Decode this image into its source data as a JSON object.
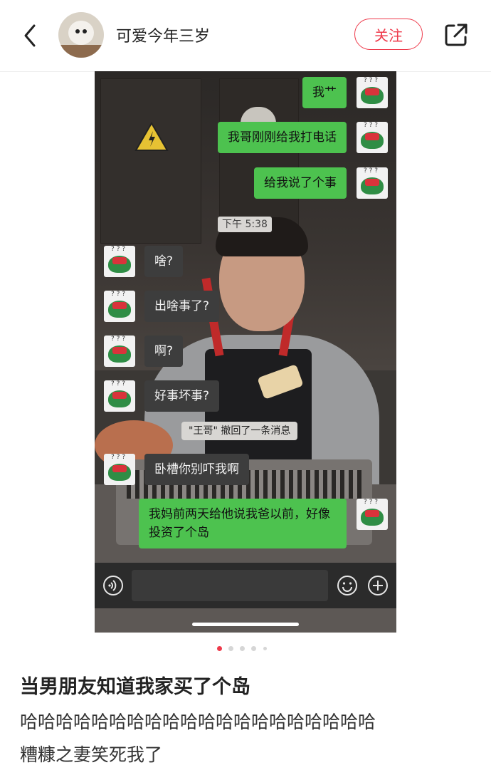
{
  "header": {
    "username": "可爱今年三岁",
    "follow_label": "关注"
  },
  "chat": {
    "messages": [
      {
        "side": "me",
        "text": "我艹"
      },
      {
        "side": "me",
        "text": "我哥刚刚给我打电话"
      },
      {
        "side": "me",
        "text": "给我说了个事"
      },
      {
        "side": "them",
        "text": "啥?"
      },
      {
        "side": "them",
        "text": "出啥事了?"
      },
      {
        "side": "them",
        "text": "啊?"
      },
      {
        "side": "them",
        "text": "好事坏事?"
      },
      {
        "side": "them",
        "text": "卧槽你别吓我啊"
      },
      {
        "side": "me",
        "text": "我妈前两天给他说我爸以前，好像投资了个岛"
      }
    ],
    "time_chip": "下午 5:38",
    "recall_notice": "\"王哥\" 撤回了一条消息"
  },
  "carousel": {
    "page": 1,
    "total": 5
  },
  "post": {
    "title": "当男朋友知道我家买了个岛",
    "line1": "哈哈哈哈哈哈哈哈哈哈哈哈哈哈哈哈哈哈哈哈",
    "line2": "糟糠之妻笑死我了"
  },
  "colors": {
    "accent": "#ee3a4b",
    "bubble_me": "#4dc24f",
    "bubble_them": "#3d3d3d"
  }
}
